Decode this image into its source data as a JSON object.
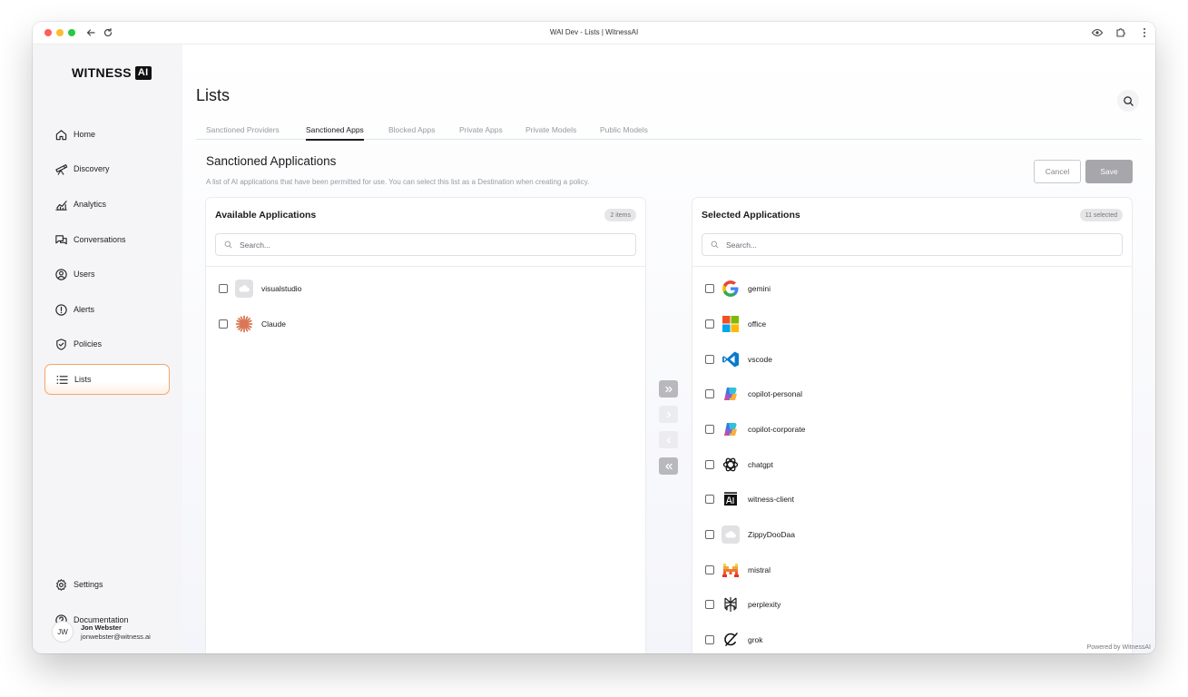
{
  "window": {
    "title": "WAI Dev - Lists | WitnessAI"
  },
  "logo": {
    "text": "WITNESS",
    "badge": "AI"
  },
  "sidebar": {
    "items": [
      {
        "label": "Home",
        "icon": "home-icon"
      },
      {
        "label": "Discovery",
        "icon": "telescope-icon"
      },
      {
        "label": "Analytics",
        "icon": "chart-line-icon"
      },
      {
        "label": "Conversations",
        "icon": "chat-icon"
      },
      {
        "label": "Users",
        "icon": "user-circle-icon"
      },
      {
        "label": "Alerts",
        "icon": "alert-icon"
      },
      {
        "label": "Policies",
        "icon": "shield-check-icon"
      },
      {
        "label": "Lists",
        "icon": "list-icon",
        "active": true
      }
    ],
    "bottom": [
      {
        "label": "Settings",
        "icon": "gear-icon"
      },
      {
        "label": "Documentation",
        "icon": "help-icon"
      }
    ],
    "user": {
      "initials": "JW",
      "name": "Jon Webster",
      "email": "jonwebster@witness.ai"
    }
  },
  "page": {
    "title": "Lists"
  },
  "tabs": [
    {
      "label": "Sanctioned Providers"
    },
    {
      "label": "Sanctioned Apps",
      "active": true
    },
    {
      "label": "Blocked Apps"
    },
    {
      "label": "Private Apps"
    },
    {
      "label": "Private Models"
    },
    {
      "label": "Public Models"
    }
  ],
  "section": {
    "title": "Sanctioned Applications",
    "description": "A list of AI applications that have been permitted for use. You can select this list as a Destination when creating a policy.",
    "cancel_label": "Cancel",
    "save_label": "Save"
  },
  "available": {
    "title": "Available Applications",
    "badge": "2 items",
    "search_placeholder": "Search...",
    "items": [
      {
        "name": "visualstudio",
        "icon": "cloud-icon"
      },
      {
        "name": "Claude",
        "icon": "claude-icon"
      }
    ]
  },
  "selected": {
    "title": "Selected Applications",
    "badge": "11 selected",
    "search_placeholder": "Search...",
    "items": [
      {
        "name": "gemini",
        "icon": "google-icon"
      },
      {
        "name": "office",
        "icon": "microsoft-icon"
      },
      {
        "name": "vscode",
        "icon": "vscode-icon"
      },
      {
        "name": "copilot-personal",
        "icon": "copilot-icon"
      },
      {
        "name": "copilot-corporate",
        "icon": "copilot-icon"
      },
      {
        "name": "chatgpt",
        "icon": "openai-icon"
      },
      {
        "name": "witness-client",
        "icon": "witness-ai-icon"
      },
      {
        "name": "ZippyDooDaa",
        "icon": "cloud-icon"
      },
      {
        "name": "mistral",
        "icon": "mistral-icon"
      },
      {
        "name": "perplexity",
        "icon": "perplexity-icon"
      },
      {
        "name": "grok",
        "icon": "grok-icon"
      }
    ]
  },
  "transfer": {
    "buttons": [
      {
        "icon": "double-chevron-right-icon",
        "enabled": true
      },
      {
        "icon": "chevron-right-icon",
        "enabled": false
      },
      {
        "icon": "chevron-left-icon",
        "enabled": false
      },
      {
        "icon": "double-chevron-left-icon",
        "enabled": true
      }
    ]
  },
  "footer": {
    "text": "Powered by WitnessAI"
  },
  "colors": {
    "accent": "#f3a56d",
    "save_disabled": "#a6a6ab"
  }
}
